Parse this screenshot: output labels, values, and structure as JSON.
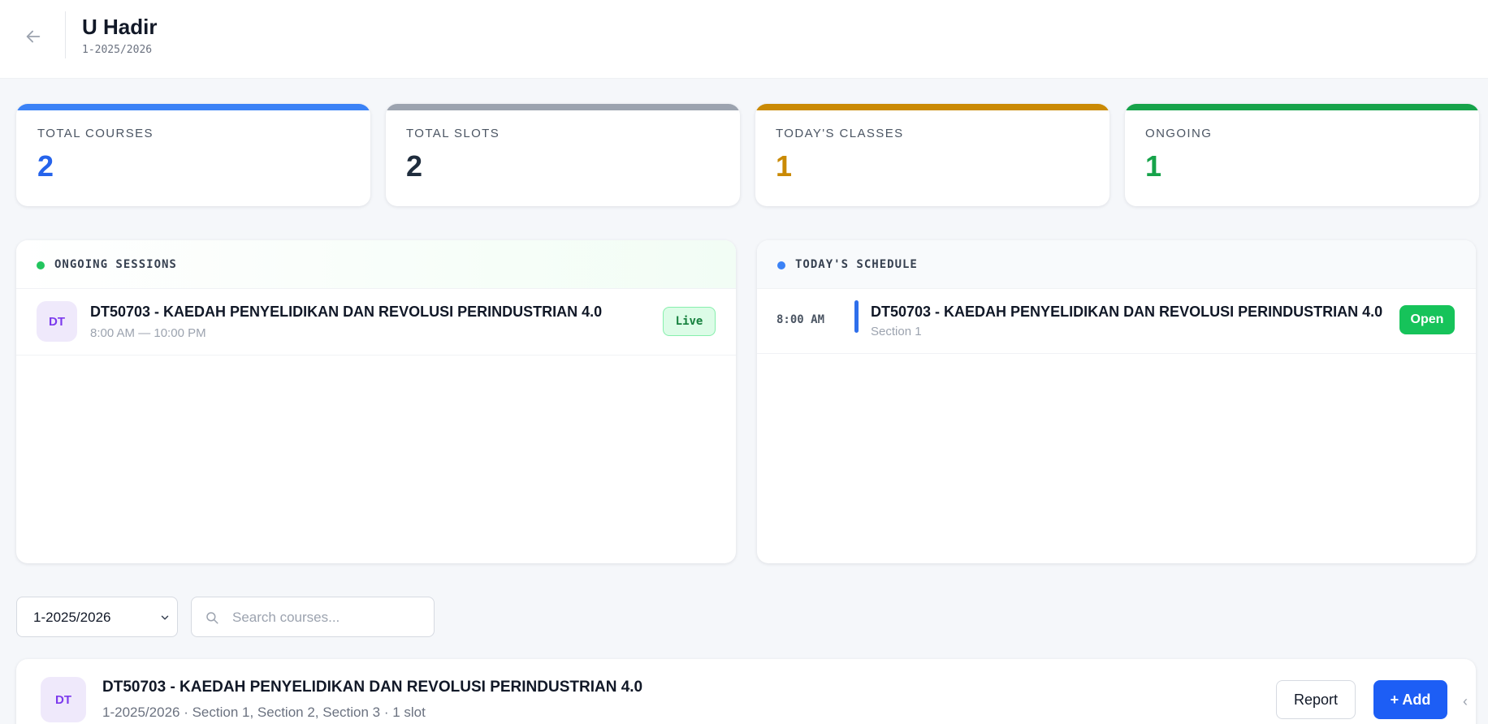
{
  "header": {
    "title": "U Hadir",
    "subtitle": "1-2025/2026",
    "back_icon": "arrow-left-icon"
  },
  "stats": [
    {
      "label": "TOTAL COURSES",
      "value": "2",
      "color": "#2563eb",
      "bar_color": "#3b82f6"
    },
    {
      "label": "TOTAL SLOTS",
      "value": "2",
      "color": "#1f2d3d",
      "bar_color": "#9ca3af"
    },
    {
      "label": "TODAY'S CLASSES",
      "value": "1",
      "color": "#ca8a04",
      "bar_color": "#ca8a04"
    },
    {
      "label": "ONGOING",
      "value": "1",
      "color": "#16a34a",
      "bar_color": "#16a34a"
    }
  ],
  "ongoing": {
    "title": "ONGOING SESSIONS",
    "dot_color": "#22c55e",
    "items": [
      {
        "avatar": "DT",
        "course": "DT50703 - KAEDAH PENYELIDIKAN DAN REVOLUSI PERINDUSTRIAN 4.0",
        "time": "8:00 AM — 10:00 PM",
        "badge": "Live"
      }
    ]
  },
  "schedule": {
    "title": "TODAY'S SCHEDULE",
    "dot_color": "#3b82f6",
    "items": [
      {
        "time": "8:00 AM",
        "course": "DT50703 - KAEDAH PENYELIDIKAN DAN REVOLUSI PERINDUSTRIAN 4.0",
        "section": "Section 1",
        "action": "Open"
      }
    ]
  },
  "filters": {
    "semester": "1-2025/2026",
    "search_placeholder": "Search courses..."
  },
  "courses": [
    {
      "avatar": "DT",
      "title": "DT50703 - KAEDAH PENYELIDIKAN DAN REVOLUSI PERINDUSTRIAN 4.0",
      "meta": "1-2025/2026 · Section 1, Section 2, Section 3 · 1 slot",
      "report_label": "Report",
      "add_label": "+ Add"
    }
  ]
}
